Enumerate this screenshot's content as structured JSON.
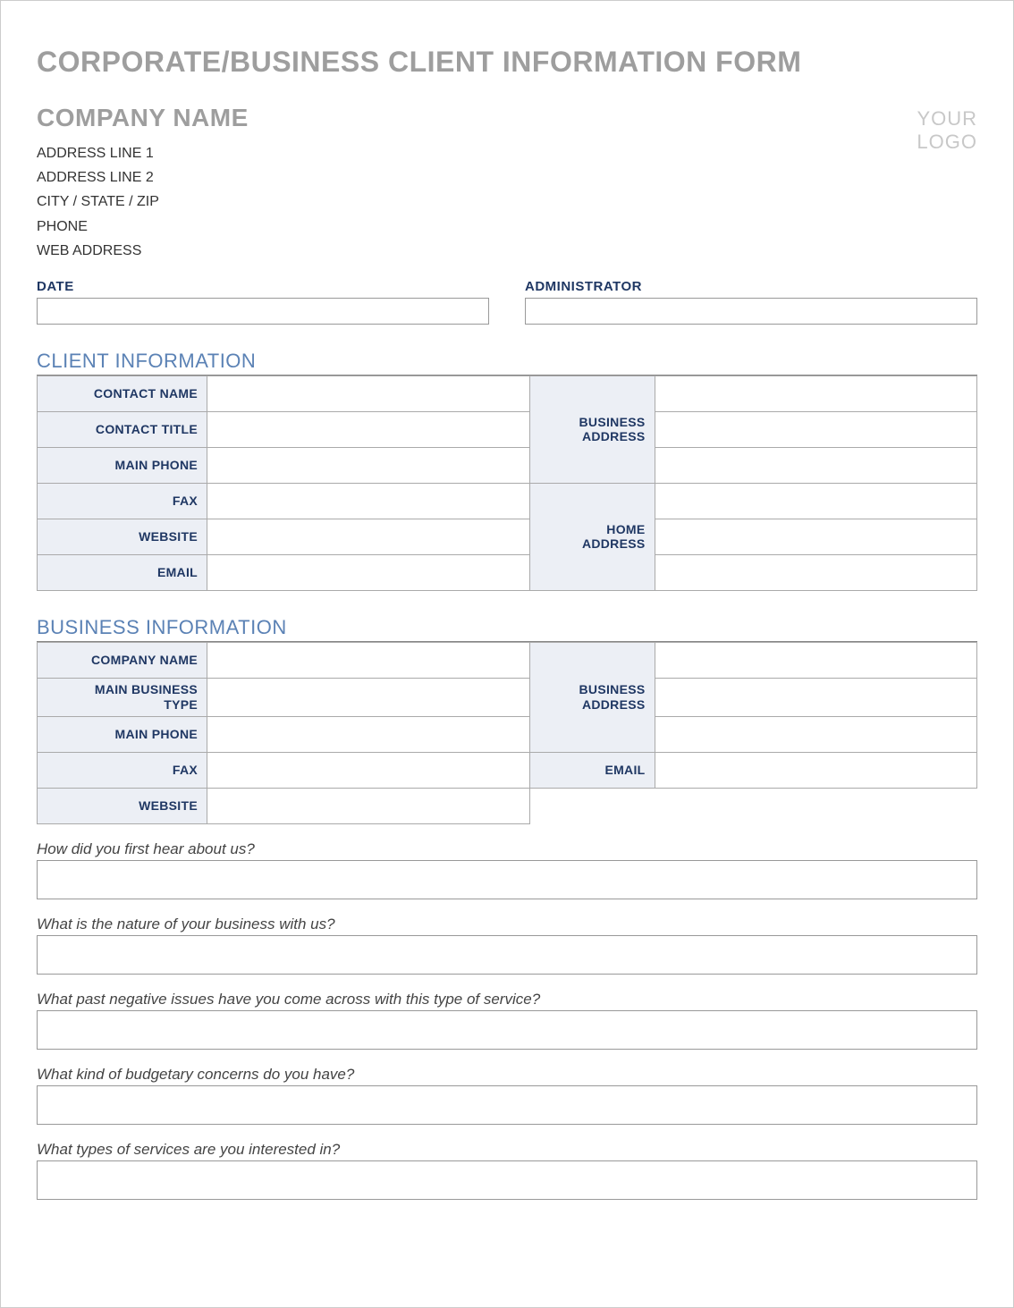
{
  "title": "CORPORATE/BUSINESS CLIENT INFORMATION FORM",
  "company": {
    "name": "COMPANY NAME",
    "address1": "ADDRESS LINE 1",
    "address2": "ADDRESS LINE 2",
    "city_state_zip": "CITY / STATE / ZIP",
    "phone": "PHONE",
    "web": "WEB ADDRESS"
  },
  "logo": {
    "line1": "YOUR",
    "line2": "LOGO"
  },
  "date_admin": {
    "date_label": "DATE",
    "admin_label": "ADMINISTRATOR"
  },
  "client_section": {
    "title": "CLIENT INFORMATION",
    "labels": {
      "contact_name": "CONTACT NAME",
      "contact_title": "CONTACT TITLE",
      "main_phone": "MAIN PHONE",
      "fax": "FAX",
      "website": "WEBSITE",
      "email": "EMAIL",
      "business_address_l1": "BUSINESS",
      "business_address_l2": "ADDRESS",
      "home_address_l1": "HOME",
      "home_address_l2": "ADDRESS"
    }
  },
  "business_section": {
    "title": "BUSINESS INFORMATION",
    "labels": {
      "company_name": "COMPANY NAME",
      "main_business_type_l1": "MAIN BUSINESS",
      "main_business_type_l2": "TYPE",
      "main_phone": "MAIN PHONE",
      "fax": "FAX",
      "website": "WEBSITE",
      "business_address_l1": "BUSINESS",
      "business_address_l2": "ADDRESS",
      "email": "EMAIL"
    }
  },
  "questions": {
    "q1": "How did you first hear about us?",
    "q2": "What is the nature of your business with us?",
    "q3": "What past negative issues have you come across with this type of service?",
    "q4": "What kind of budgetary concerns do you have?",
    "q5": "What types of services are you interested in?"
  }
}
